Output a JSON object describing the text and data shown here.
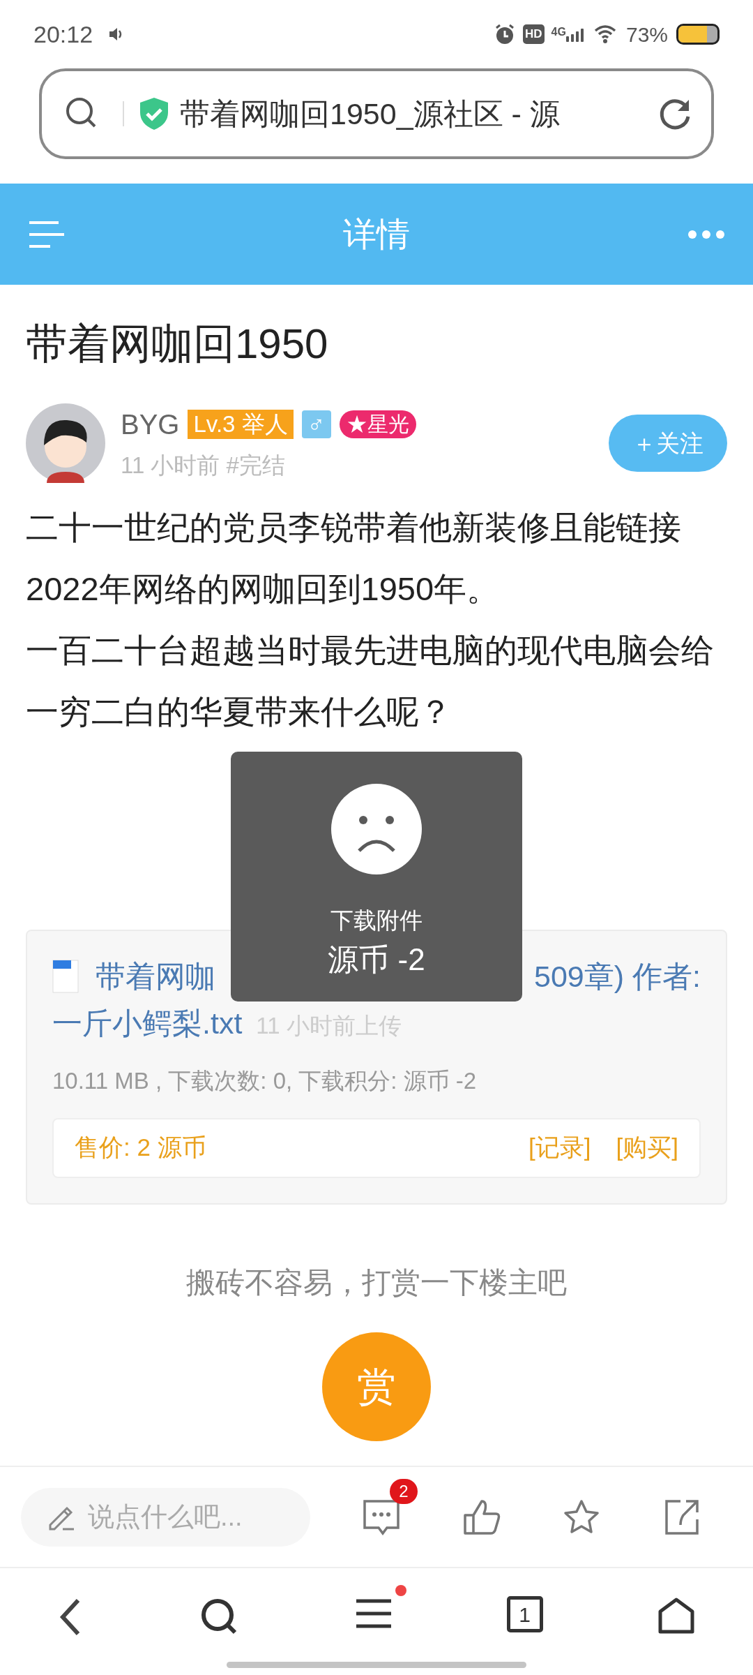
{
  "status_bar": {
    "time": "20:12",
    "hd": "HD",
    "network": "4G",
    "battery": "73%"
  },
  "url_bar": {
    "title": "带着网咖回1950_源社区 - 源"
  },
  "header": {
    "title": "详情"
  },
  "post": {
    "title": "带着网咖回1950",
    "author": {
      "name": "BYG",
      "level": "Lv.3 举人",
      "gender": "♂",
      "badge": "★星光"
    },
    "meta": "11 小时前 #完结",
    "follow": "＋关注",
    "paragraphs": [
      "二十一世纪的党员李锐带着他新装修且能链接2022年网络的网咖回到1950年。",
      "一百二十台超越当时最先进电脑的现代电脑会给一穷二白的华夏带来什么呢？"
    ]
  },
  "attachment": {
    "name_parts": [
      "带着网咖",
      "509章) 作者:",
      "一斤小鳄梨.txt"
    ],
    "uploaded": "11 小时前上传",
    "info": "10.11 MB , 下载次数: 0, 下载积分: 源币 -2",
    "price": "售价: 2 源币",
    "links": [
      "[记录]",
      "[购买]"
    ]
  },
  "toast": {
    "title": "下载附件",
    "message": "源币 -2"
  },
  "reward": {
    "prompt": "搬砖不容易，打赏一下楼主吧",
    "button": "赏"
  },
  "comment_bar": {
    "placeholder": "说点什么吧...",
    "comment_count": "2"
  },
  "nav": {
    "tab_count": "1",
    "menu_badge": true
  }
}
